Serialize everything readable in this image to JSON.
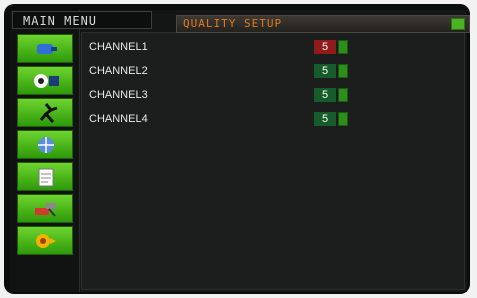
{
  "sidebar": {
    "title": "MAIN MENU",
    "items": [
      {
        "icon": "camera-icon"
      },
      {
        "icon": "record-icon"
      },
      {
        "icon": "motion-icon"
      },
      {
        "icon": "network-icon"
      },
      {
        "icon": "document-icon"
      },
      {
        "icon": "tools-icon"
      },
      {
        "icon": "alarm-icon"
      }
    ]
  },
  "header": {
    "title": "QUALITY SETUP"
  },
  "channels": [
    {
      "label": "CHANNEL1",
      "value": "5"
    },
    {
      "label": "CHANNEL2",
      "value": "5"
    },
    {
      "label": "CHANNEL3",
      "value": "5"
    },
    {
      "label": "CHANNEL4",
      "value": "5"
    }
  ],
  "colors": {
    "accent": "#e07a1f",
    "selected_value_bg": "#8f1b1b",
    "value_bg": "#155c2a",
    "menu_green": "#4bb224"
  }
}
